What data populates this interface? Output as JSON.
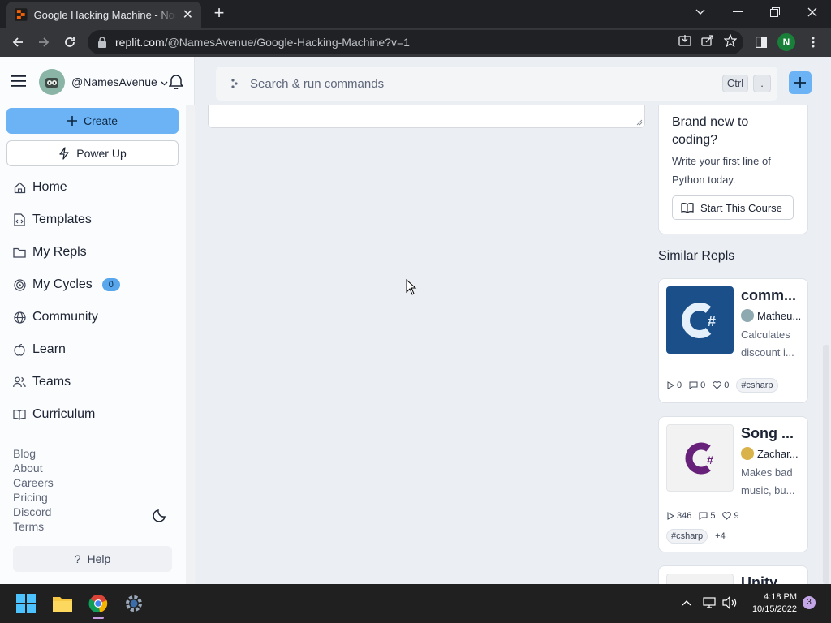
{
  "browser": {
    "tab_title": "Google Hacking Machine - NodeJS",
    "url_host": "replit.com",
    "url_path": "/@NamesAvenue/Google-Hacking-Machine?v=1",
    "profile_initial": "N"
  },
  "sidebar": {
    "username": "@NamesAvenue",
    "create_label": "Create",
    "powerup_label": "Power Up",
    "nav": [
      {
        "label": "Home",
        "icon": "home-icon"
      },
      {
        "label": "Templates",
        "icon": "templates-icon"
      },
      {
        "label": "My Repls",
        "icon": "folder-icon"
      },
      {
        "label": "My Cycles",
        "icon": "cycles-icon",
        "badge": "0"
      },
      {
        "label": "Community",
        "icon": "globe-icon"
      },
      {
        "label": "Learn",
        "icon": "apple-icon"
      },
      {
        "label": "Teams",
        "icon": "teams-icon"
      },
      {
        "label": "Curriculum",
        "icon": "book-icon"
      }
    ],
    "footer_links": [
      "Blog",
      "About",
      "Careers",
      "Pricing",
      "Discord",
      "Terms"
    ],
    "help_label": "Help"
  },
  "topbar": {
    "search_placeholder": "Search & run commands",
    "shortcut_key1": "Ctrl",
    "shortcut_key2": "."
  },
  "course_card": {
    "title": "Brand new to coding?",
    "description": "Write your first line of Python today.",
    "button_label": "Start This Course"
  },
  "similar": {
    "heading": "Similar Repls",
    "repls": [
      {
        "title": "comm...",
        "author": "Matheu...",
        "description": "Calculates discount i...",
        "runs": "0",
        "comments": "0",
        "likes": "0",
        "tags": [
          "#csharp"
        ],
        "more_tags": "",
        "thumb_color": "#1b4f8a"
      },
      {
        "title": "Song ...",
        "author": "Zachar...",
        "description": "Makes bad music, bu...",
        "runs": "346",
        "comments": "5",
        "likes": "9",
        "tags": [
          "#csharp"
        ],
        "more_tags": "+4",
        "thumb_color": "#f2f2f2"
      },
      {
        "title": "Unity"
      }
    ]
  },
  "taskbar": {
    "time": "4:18 PM",
    "date": "10/15/2022",
    "notification_count": "3"
  }
}
